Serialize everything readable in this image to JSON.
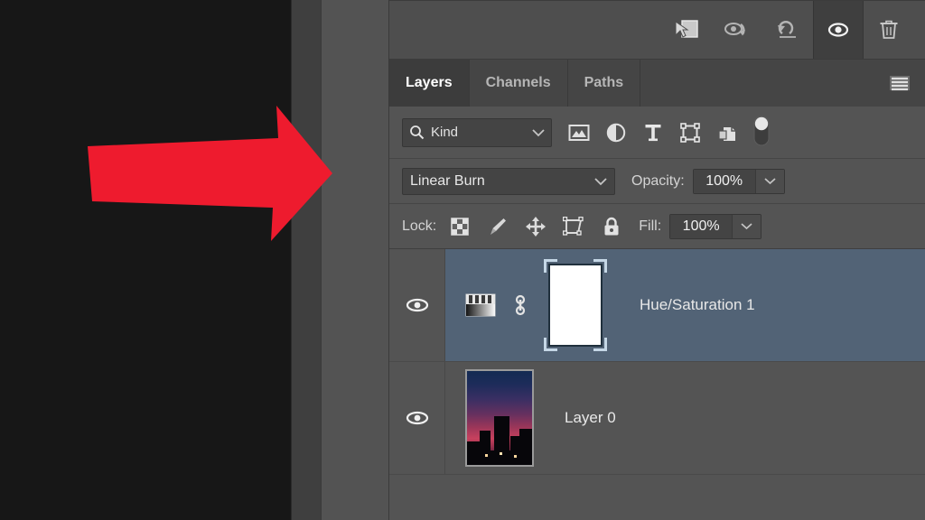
{
  "app": {
    "panel_title": "Layers",
    "background_color": "#545454",
    "selection_color": "#526376",
    "arrow_color": "#ee1b2e"
  },
  "comps_toolbar": {
    "buttons": [
      {
        "name": "apply-layer-comp-icon",
        "label": "Apply Layer Comp",
        "active": false
      },
      {
        "name": "last-document-state-icon",
        "label": "Last Document State",
        "active": false
      },
      {
        "name": "revert-icon",
        "label": "Revert",
        "active": false
      },
      {
        "name": "toggle-visibility-icon",
        "label": "Toggle Visibility",
        "active": true
      },
      {
        "name": "delete-icon",
        "label": "Delete",
        "active": false
      }
    ]
  },
  "tabs": [
    {
      "label": "Layers",
      "active": true
    },
    {
      "label": "Channels",
      "active": false
    },
    {
      "label": "Paths",
      "active": false
    }
  ],
  "tab_menu": {
    "label": "Panel Menu",
    "icon": "hamburger-menu-icon"
  },
  "filter_row": {
    "kind_label": "Kind",
    "search_icon": "search-icon",
    "dropdown_icon": "chevron-down-icon",
    "filter_icons": [
      {
        "name": "pixel-filter-icon",
        "label": "Pixel Layers"
      },
      {
        "name": "adjustment-filter-icon",
        "label": "Adjustment Layers"
      },
      {
        "name": "type-filter-icon",
        "label": "Type Layers"
      },
      {
        "name": "shape-filter-icon",
        "label": "Shape Layers"
      },
      {
        "name": "smart-object-filter-icon",
        "label": "Smart Objects"
      }
    ],
    "toggle": {
      "name": "filter-toggle-switch",
      "label": "Turn Filtering On/Off",
      "state": "off"
    }
  },
  "blend_row": {
    "blend_mode": "Linear Burn",
    "opacity_label": "Opacity:",
    "opacity_value": "100%"
  },
  "lock_row": {
    "lock_label": "Lock:",
    "lock_icons": [
      {
        "name": "lock-transparent-pixels-icon",
        "label": "Lock Transparent Pixels"
      },
      {
        "name": "lock-image-pixels-icon",
        "label": "Lock Image Pixels"
      },
      {
        "name": "lock-position-icon",
        "label": "Lock Position"
      },
      {
        "name": "lock-artboard-icon",
        "label": "Prevent Auto-Nesting"
      },
      {
        "name": "lock-all-icon",
        "label": "Lock All"
      }
    ],
    "fill_label": "Fill:",
    "fill_value": "100%"
  },
  "layers": [
    {
      "name": "Hue/Saturation 1",
      "type": "adjustment",
      "selected": true,
      "visible": true,
      "linked": true,
      "mask_active": true,
      "thumbnail": "hue-saturation-adjustment-icon",
      "mask": "white-layer-mask"
    },
    {
      "name": "Layer 0",
      "type": "pixel",
      "selected": false,
      "visible": true,
      "linked": false,
      "mask_active": false,
      "thumbnail": "sunset-cityscape-photo"
    }
  ],
  "annotation": {
    "arrow": {
      "name": "red-pointer-arrow",
      "direction": "right",
      "points_to": "blend-mode-dropdown"
    }
  }
}
